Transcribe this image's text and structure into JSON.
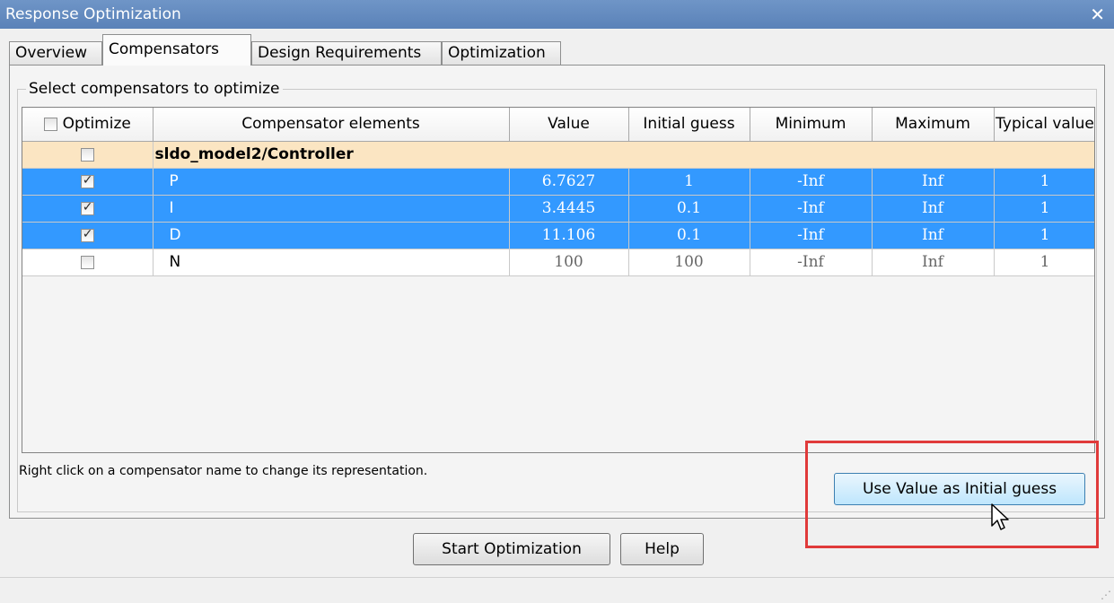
{
  "window": {
    "title": "Response Optimization",
    "close_glyph": "✕"
  },
  "tabs": [
    {
      "label": "Overview"
    },
    {
      "label": "Compensators",
      "active": true
    },
    {
      "label": "Design Requirements"
    },
    {
      "label": "Optimization"
    }
  ],
  "panel": {
    "group_title": "Select compensators to optimize",
    "hint": "Right click on a compensator name to change its representation.",
    "use_value_button": "Use Value as Initial guess"
  },
  "table": {
    "headers": {
      "optimize": "Optimize",
      "elements": "Compensator elements",
      "value": "Value",
      "initial": "Initial guess",
      "minimum": "Minimum",
      "maximum": "Maximum",
      "typical": "Typical value"
    },
    "group_row": {
      "name": "sldo_model2/Controller",
      "checked": false
    },
    "rows": [
      {
        "name": "P",
        "value": "6.7627",
        "initial": "1",
        "minimum": "-Inf",
        "maximum": "Inf",
        "typical": "1",
        "checked": true
      },
      {
        "name": "I",
        "value": "3.4445",
        "initial": "0.1",
        "minimum": "-Inf",
        "maximum": "Inf",
        "typical": "1",
        "checked": true
      },
      {
        "name": "D",
        "value": "11.106",
        "initial": "0.1",
        "minimum": "-Inf",
        "maximum": "Inf",
        "typical": "1",
        "checked": true
      },
      {
        "name": "N",
        "value": "100",
        "initial": "100",
        "minimum": "-Inf",
        "maximum": "Inf",
        "typical": "1",
        "checked": false
      }
    ]
  },
  "footer": {
    "start_button": "Start Optimization",
    "help_button": "Help"
  },
  "colors": {
    "selection": "#3399ff",
    "group_row": "#fbe5c2",
    "highlight_box": "#e03a3a",
    "titlebar": "#6f95c7"
  },
  "icons": [
    "close-icon",
    "checkbox-icon",
    "mouse-cursor-icon",
    "resize-grip-icon"
  ]
}
